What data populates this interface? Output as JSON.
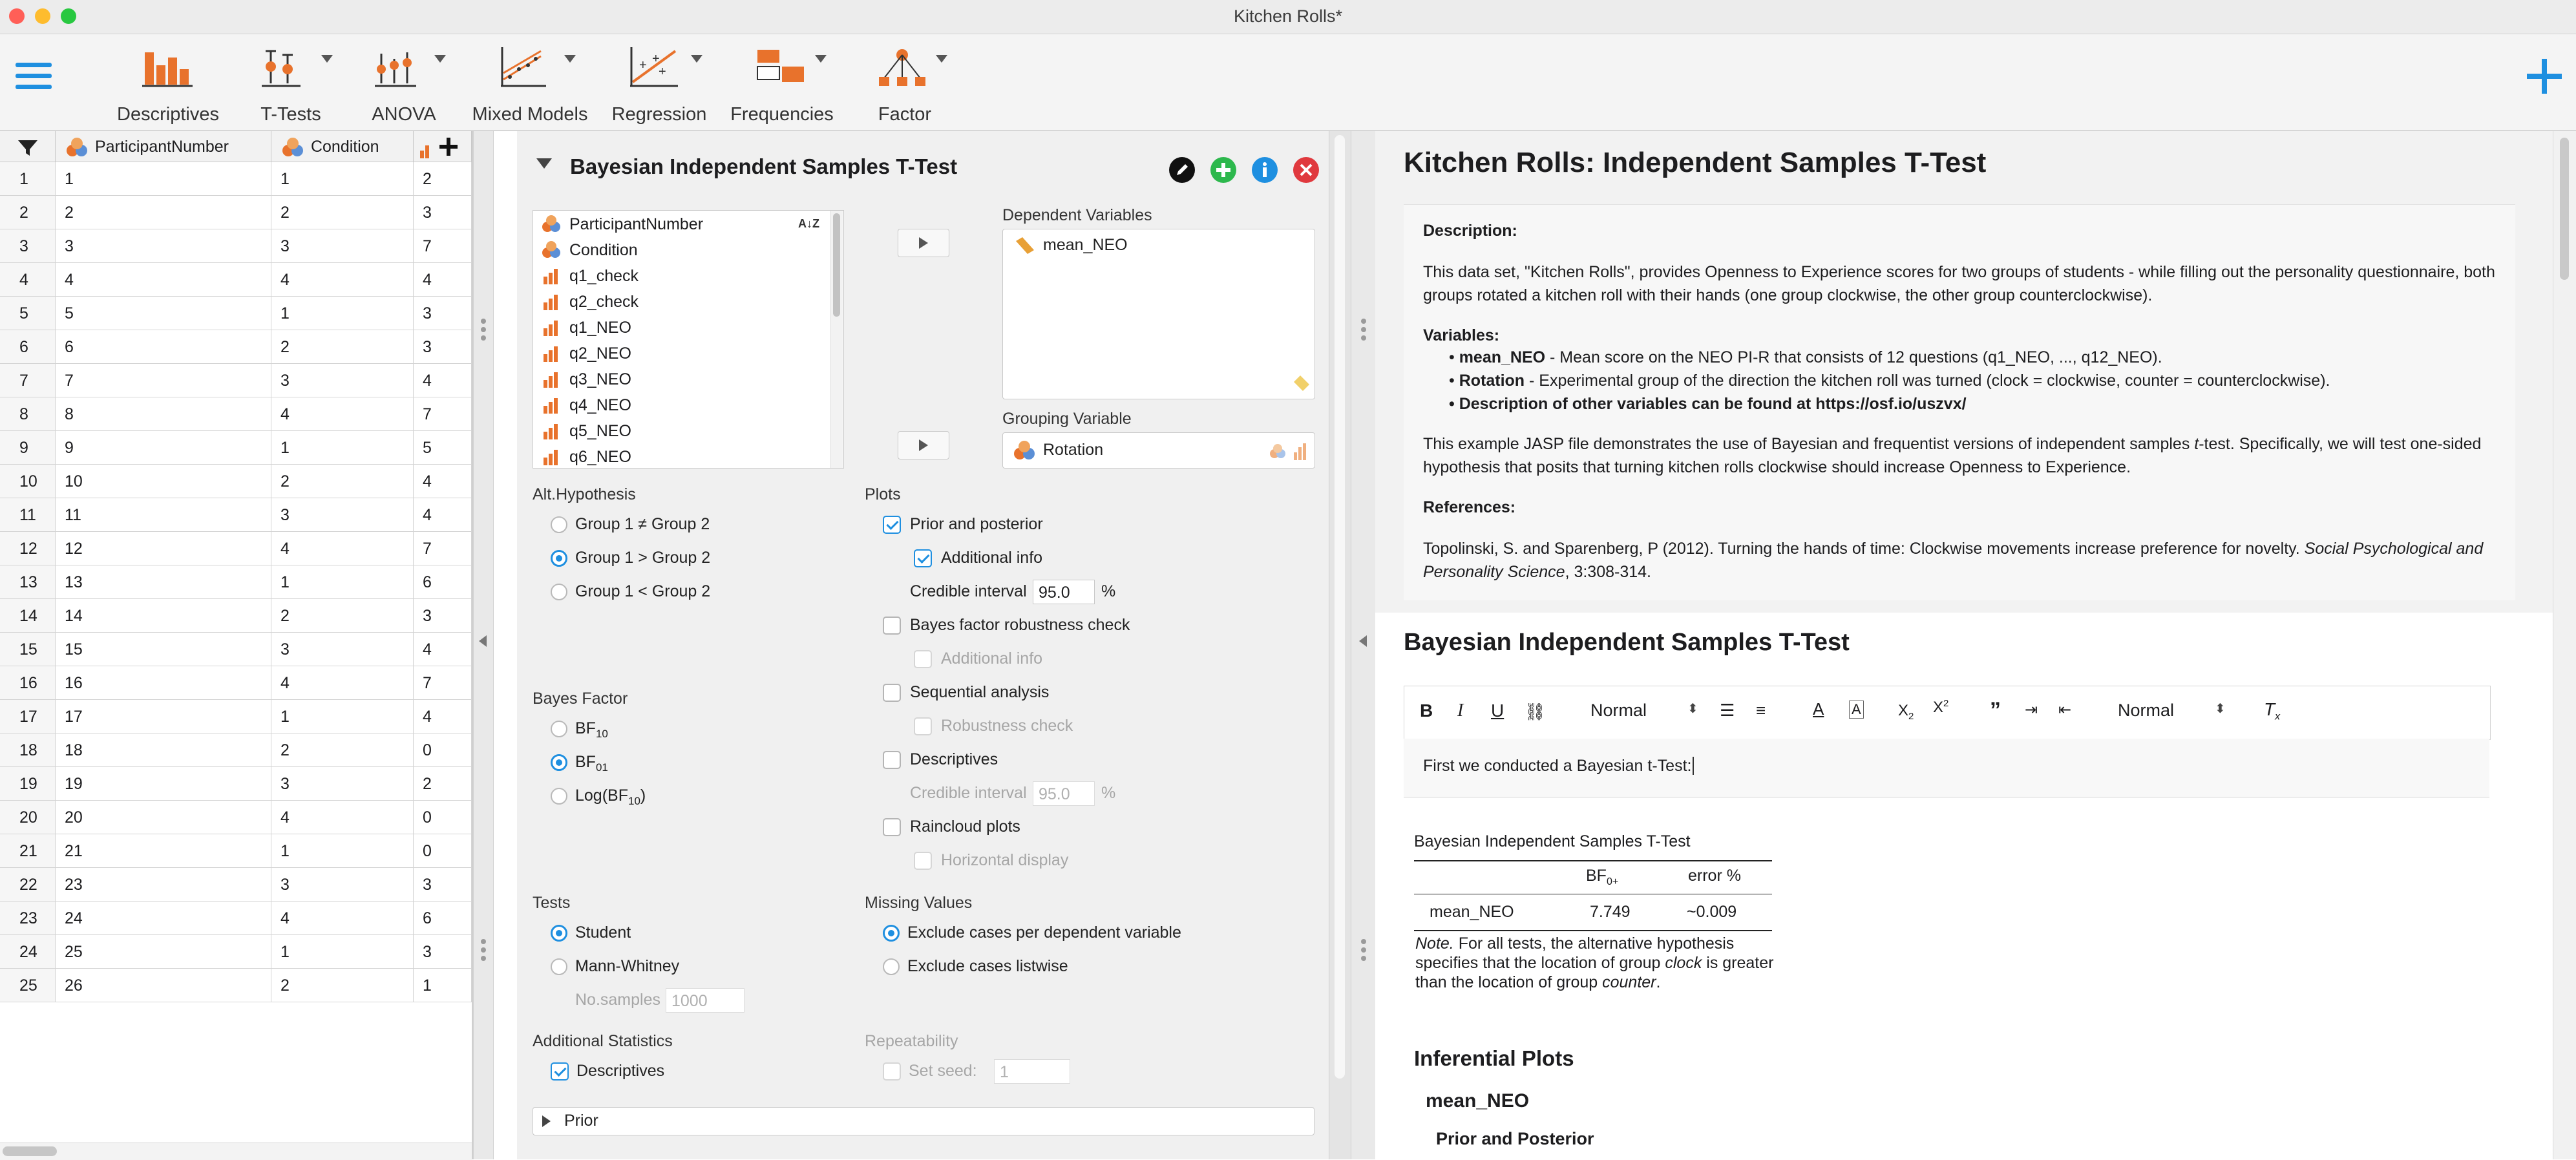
{
  "window": {
    "title": "Kitchen Rolls*"
  },
  "ribbon": {
    "items": [
      {
        "label": "Descriptives"
      },
      {
        "label": "T-Tests"
      },
      {
        "label": "ANOVA"
      },
      {
        "label": "Mixed Models"
      },
      {
        "label": "Regression"
      },
      {
        "label": "Frequencies"
      },
      {
        "label": "Factor"
      }
    ]
  },
  "grid": {
    "columns": [
      "ParticipantNumber",
      "Condition"
    ],
    "rows": [
      [
        "1",
        "1",
        "1",
        "2"
      ],
      [
        "2",
        "2",
        "2",
        "3"
      ],
      [
        "3",
        "3",
        "3",
        "7"
      ],
      [
        "4",
        "4",
        "4",
        "4"
      ],
      [
        "5",
        "5",
        "1",
        "3"
      ],
      [
        "6",
        "6",
        "2",
        "3"
      ],
      [
        "7",
        "7",
        "3",
        "4"
      ],
      [
        "8",
        "8",
        "4",
        "7"
      ],
      [
        "9",
        "9",
        "1",
        "5"
      ],
      [
        "10",
        "10",
        "2",
        "4"
      ],
      [
        "11",
        "11",
        "3",
        "4"
      ],
      [
        "12",
        "12",
        "4",
        "7"
      ],
      [
        "13",
        "13",
        "1",
        "6"
      ],
      [
        "14",
        "14",
        "2",
        "3"
      ],
      [
        "15",
        "15",
        "3",
        "4"
      ],
      [
        "16",
        "16",
        "4",
        "7"
      ],
      [
        "17",
        "17",
        "1",
        "4"
      ],
      [
        "18",
        "18",
        "2",
        "0"
      ],
      [
        "19",
        "19",
        "3",
        "2"
      ],
      [
        "20",
        "20",
        "4",
        "0"
      ],
      [
        "21",
        "21",
        "1",
        "0"
      ],
      [
        "22",
        "23",
        "3",
        "3"
      ],
      [
        "23",
        "24",
        "4",
        "6"
      ],
      [
        "24",
        "25",
        "1",
        "3"
      ],
      [
        "25",
        "26",
        "2",
        "1"
      ]
    ]
  },
  "analysis": {
    "title": "Bayesian Independent Samples T-Test",
    "variables": [
      "ParticipantNumber",
      "Condition",
      "q1_check",
      "q2_check",
      "q1_NEO",
      "q2_NEO",
      "q3_NEO",
      "q4_NEO",
      "q5_NEO",
      "q6_NEO"
    ],
    "dependent_label": "Dependent Variables",
    "dependent_value": "mean_NEO",
    "grouping_label": "Grouping Variable",
    "grouping_value": "Rotation",
    "alt_hyp": {
      "header": "Alt.Hypothesis",
      "options": [
        "Group 1 ≠ Group 2",
        "Group 1 > Group 2",
        "Group 1 < Group 2"
      ],
      "selected": 1
    },
    "plots": {
      "header": "Plots",
      "prior_posterior": "Prior and posterior",
      "additional_info": "Additional info",
      "credible_interval": "Credible interval",
      "ci_value": "95.0",
      "pct": "%",
      "bf_robustness": "Bayes factor robustness check",
      "additional_info2": "Additional info",
      "sequential": "Sequential analysis",
      "robustness": "Robustness check",
      "descriptives": "Descriptives",
      "credible_interval2": "Credible interval",
      "ci_value2": "95.0",
      "pct2": "%",
      "raincloud": "Raincloud plots",
      "horizontal": "Horizontal display"
    },
    "bayes_factor": {
      "header": "Bayes Factor",
      "bf10": "BF",
      "bf10_sub": "10",
      "bf01": "BF",
      "bf01_sub": "01",
      "log": "Log(BF",
      "log_sub": "10",
      "log_end": ")",
      "selected": 1
    },
    "tests": {
      "header": "Tests",
      "student": "Student",
      "mann": "Mann-Whitney",
      "samples_label": "No.samples",
      "samples_value": "1000"
    },
    "missing": {
      "header": "Missing Values",
      "per_dep": "Exclude cases per dependent variable",
      "listwise": "Exclude cases listwise"
    },
    "additional": {
      "header": "Additional Statistics",
      "descriptives": "Descriptives"
    },
    "repeat": {
      "header": "Repeatability",
      "seed_label": "Set seed:",
      "seed_value": "1"
    },
    "prior_section": "Prior"
  },
  "results": {
    "heading": "Kitchen Rolls: Independent Samples T-Test",
    "desc_label": "Description:",
    "desc_text": "This data set, \"Kitchen Rolls\", provides Openness to Experience scores for two groups of students - while filling out the personality questionnaire, both groups rotated a kitchen roll with their hands (one group clockwise, the other group counterclockwise).",
    "vars_label": "Variables:",
    "var1_name": "mean_NEO",
    "var1_text": " - Mean score on the NEO PI-R that consists of 12 questions (q1_NEO, ..., q12_NEO).",
    "var2_name": "Rotation",
    "var2_text": " - Experimental group of the direction the kitchen roll was turned (clock = clockwise, counter = counterclockwise).",
    "var3": "Description of other variables can be found at https://osf.io/uszvx/",
    "example_a": "This example JASP file demonstrates the use of Bayesian and frequentist versions of independent samples ",
    "example_t": "t",
    "example_b": "-test. Specifically, we will test one-sided hypothesis that posits that turning kitchen rolls clockwise should increase Openness to Experience.",
    "refs_label": "References:",
    "ref_a": "Topolinski, S. and Sparenberg, P (2012). Turning the hands of time: Clockwise movements increase preference for novelty. ",
    "ref_journal": "Social Psychological and Personality Science",
    "ref_b": ", 3:308-314.",
    "section_title": "Bayesian Independent Samples T-Test",
    "editor_style1": "Normal",
    "editor_style2": "Normal",
    "editor_text": "First we conducted a Bayesian t-Test: ",
    "table_title": "Bayesian Independent Samples T-Test",
    "col_bf": "BF",
    "col_bf_sub": "0+",
    "col_err": "error %",
    "row_name": "mean_NEO",
    "row_bf": "7.749",
    "row_err": "~0.009",
    "note_label": "Note.",
    "note_a": " For all tests, the alternative hypothesis specifies that the location of group ",
    "note_clock": "clock",
    "note_b": " is greater than the location of group ",
    "note_counter": "counter",
    "note_c": ".",
    "plots_title": "Inferential Plots",
    "plots_var": "mean_NEO",
    "plots_sub": "Prior and Posterior"
  },
  "colors": {
    "accent_blue": "#1e8fe0",
    "ribbon_orange": "#e8722c",
    "green": "#2db84d",
    "red": "#e0393e"
  }
}
